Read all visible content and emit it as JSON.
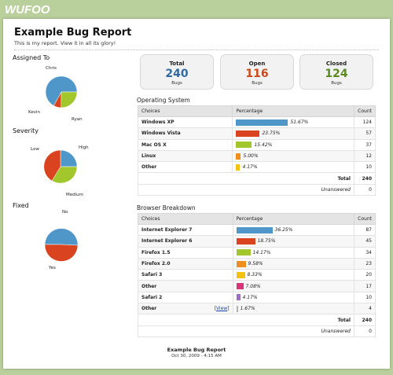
{
  "brand": "WUFOO",
  "report": {
    "title": "Example Bug Report",
    "subtitle": "This is my report. View it in all its glory!"
  },
  "colors": {
    "total": "#2f6aa1",
    "open": "#c84a1c",
    "closed": "#5a8a1e",
    "blue": "#4f97c8",
    "red": "#d9431f",
    "green": "#a2c72c",
    "orange": "#ef8f1e",
    "yellow": "#f2c313",
    "pink": "#d9347a",
    "purple": "#9c6fc7",
    "gray": "#b0b0b0"
  },
  "pies": [
    {
      "title": "Assigned To",
      "labels": [
        "Chris",
        "Kevin",
        "Ryan"
      ]
    },
    {
      "title": "Severity",
      "labels": [
        "High",
        "Low",
        "Medium"
      ]
    },
    {
      "title": "Fixed",
      "labels": [
        "No",
        "Yes"
      ]
    }
  ],
  "stats": {
    "total": {
      "label": "Total",
      "value": "240",
      "sub": "Bugs"
    },
    "open": {
      "label": "Open",
      "value": "116",
      "sub": "Bugs"
    },
    "closed": {
      "label": "Closed",
      "value": "124",
      "sub": "Bugs"
    }
  },
  "os_table": {
    "title": "Operating System",
    "headers": [
      "Choices",
      "Percentage",
      "Count"
    ],
    "rows": [
      {
        "choice": "Windows XP",
        "pct_text": "51.67%",
        "count": "124"
      },
      {
        "choice": "Windows Vista",
        "pct_text": "23.75%",
        "count": "57"
      },
      {
        "choice": "Mac OS X",
        "pct_text": "15.42%",
        "count": "37"
      },
      {
        "choice": "Linux",
        "pct_text": "5.00%",
        "count": "12"
      },
      {
        "choice": "Other",
        "pct_text": "4.17%",
        "count": "10"
      }
    ],
    "total_label": "Total",
    "total_value": "240",
    "unanswered_label": "Unanswered",
    "unanswered_value": "0"
  },
  "browser_table": {
    "title": "Browser Breakdown",
    "headers": [
      "Choices",
      "Percentage",
      "Count"
    ],
    "rows": [
      {
        "choice": "Internet Explorer 7",
        "pct_text": "36.25%",
        "count": "87"
      },
      {
        "choice": "Internet Explorer 6",
        "pct_text": "18.75%",
        "count": "45"
      },
      {
        "choice": "Firefox 1.5",
        "pct_text": "14.17%",
        "count": "34"
      },
      {
        "choice": "Firefox 2.0",
        "pct_text": "9.58%",
        "count": "23"
      },
      {
        "choice": "Safari 3",
        "pct_text": "8.33%",
        "count": "20"
      },
      {
        "choice": "Other",
        "pct_text": "7.08%",
        "count": "17"
      },
      {
        "choice": "Safari 2",
        "pct_text": "4.17%",
        "count": "10"
      },
      {
        "choice": "Other",
        "pct_text": "1.67%",
        "count": "4"
      }
    ],
    "view_link": "View",
    "total_label": "Total",
    "total_value": "240",
    "unanswered_label": "Unanswered",
    "unanswered_value": "0"
  },
  "footer": {
    "title": "Example Bug Report",
    "date": "Oct 30, 2009 - 4:15 AM"
  }
}
